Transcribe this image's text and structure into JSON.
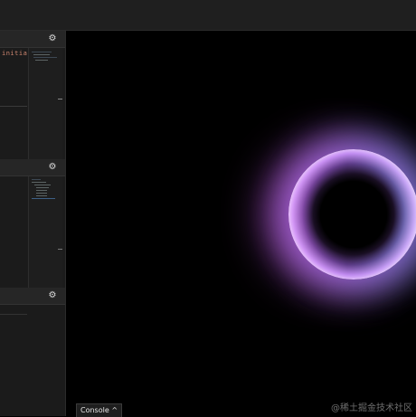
{
  "panels": [
    {
      "code_text": "initial",
      "gear_icon": "gear-icon"
    },
    {
      "code_text": "",
      "gear_icon": "gear-icon"
    },
    {
      "code_text": "",
      "gear_icon": "gear-icon"
    }
  ],
  "console": {
    "label": "Console",
    "chevron": "^"
  },
  "watermark": "@稀土掘金技术社区",
  "colors": {
    "background": "#000000",
    "panel": "#1c1c1c",
    "ring_purple": "#c08af0",
    "ring_blue": "#5a96e6"
  }
}
